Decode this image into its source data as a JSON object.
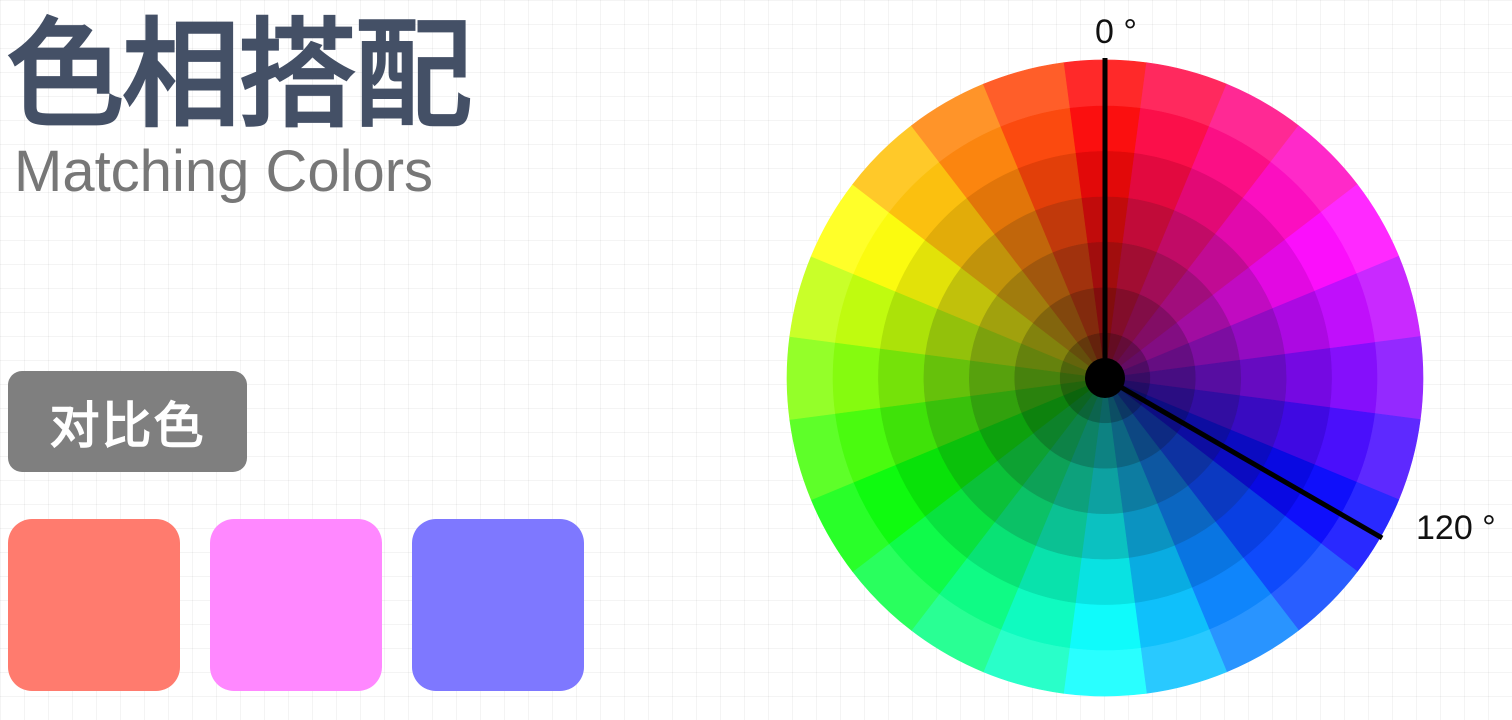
{
  "title": {
    "chinese": "色相搭配",
    "english": "Matching Colors"
  },
  "category": {
    "label": "对比色"
  },
  "swatches": [
    {
      "name": "red",
      "color": "#ff7b6e"
    },
    {
      "name": "magenta",
      "color": "#ff88ff"
    },
    {
      "name": "blue-violet",
      "color": "#7e78ff"
    }
  ],
  "wheel": {
    "hue_segments": 24,
    "rings": 7,
    "pointers": [
      {
        "label": "0 °",
        "angle_deg": 0
      },
      {
        "label": "120 °",
        "angle_deg": 120
      }
    ]
  },
  "colors": {
    "title": "#445066",
    "subtitle": "#777777",
    "badge": "#7f7f7f",
    "pointer": "#000000"
  }
}
